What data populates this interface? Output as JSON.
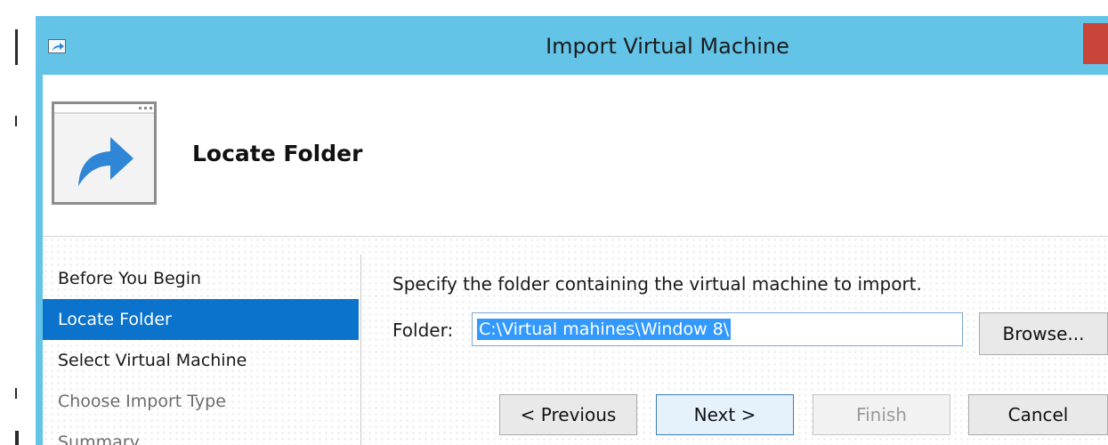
{
  "window": {
    "title": "Import Virtual Machine",
    "accent_color": "#63c4e8",
    "title_icon": "import-arrow-icon",
    "close_button_color": "#c9453a"
  },
  "header": {
    "icon": "import-wizard-icon",
    "title": "Locate Folder"
  },
  "nav": {
    "items": [
      {
        "label": "Before You Begin",
        "state": "normal"
      },
      {
        "label": "Locate Folder",
        "state": "selected"
      },
      {
        "label": "Select Virtual Machine",
        "state": "normal"
      },
      {
        "label": "Choose Import Type",
        "state": "disabled"
      },
      {
        "label": "Summary",
        "state": "disabled"
      }
    ],
    "selected_color": "#0b73cb"
  },
  "main": {
    "instruction": "Specify the folder containing the virtual machine to import.",
    "folder_label": "Folder:",
    "folder_value": "C:\\Virtual mahines\\Window 8\\",
    "browse_label": "Browse..."
  },
  "footer": {
    "previous_label": "< Previous",
    "next_label": "Next >",
    "finish_label": "Finish",
    "cancel_label": "Cancel"
  }
}
